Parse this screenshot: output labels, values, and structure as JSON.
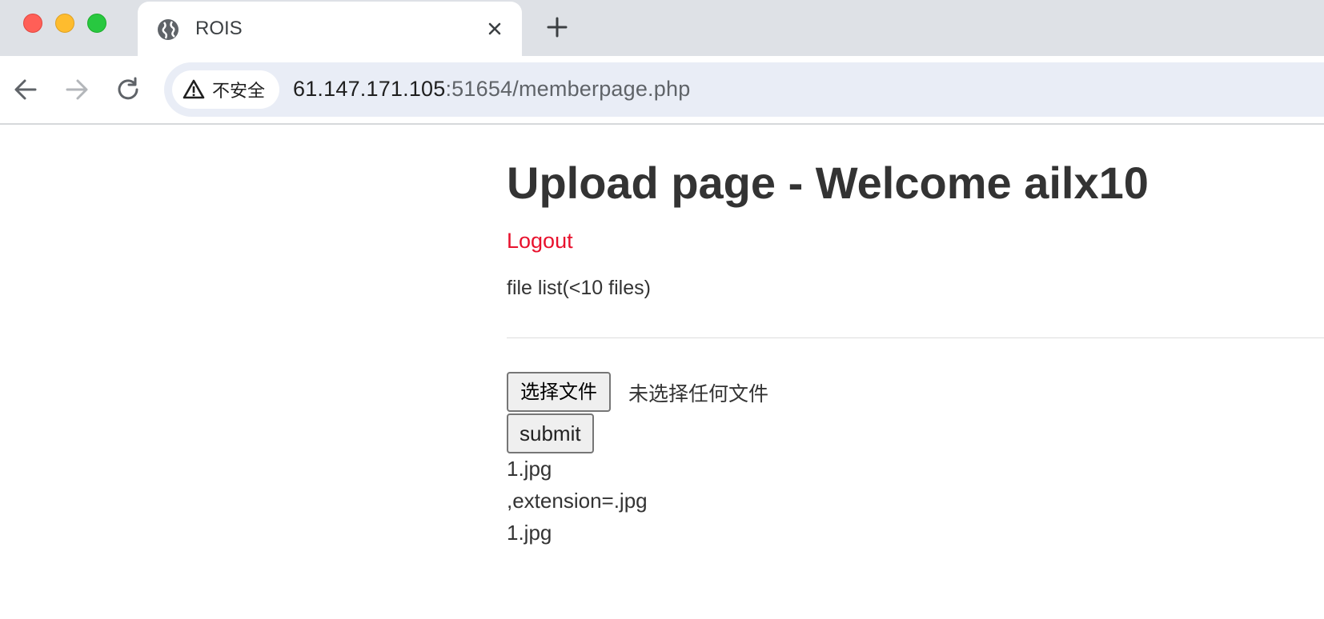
{
  "browser": {
    "tab": {
      "title": "ROIS",
      "icon": "globe-icon",
      "close_icon": "close-icon"
    },
    "new_tab_icon": "plus-icon",
    "nav": {
      "back_icon": "arrow-left-icon",
      "forward_icon": "arrow-right-icon",
      "reload_icon": "reload-icon"
    },
    "security": {
      "icon": "warning-triangle-icon",
      "label": "不安全"
    },
    "url": {
      "host": "61.147.171.105",
      "rest": ":51654/memberpage.php"
    },
    "colors": {
      "tabbar_bg": "#dee1e6",
      "omnibox_bg": "#e9edf6"
    }
  },
  "page": {
    "title": "Upload page - Welcome ailx10",
    "logout_label": "Logout",
    "file_list_label": "file list(<10 files)",
    "upload": {
      "choose_file_label": "选择文件",
      "no_file_text": "未选择任何文件",
      "submit_label": "submit"
    },
    "output_lines": [
      "1.jpg",
      ",extension=.jpg",
      "1.jpg"
    ],
    "colors": {
      "text": "#333333",
      "link": "#e8112d"
    }
  }
}
